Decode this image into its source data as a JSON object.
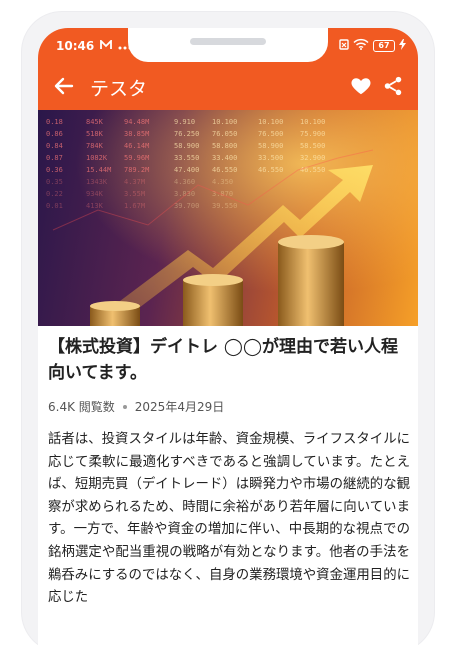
{
  "status_bar": {
    "time": "10:46",
    "battery_level": "67"
  },
  "app_bar": {
    "title": "テスタ"
  },
  "article": {
    "headline": "【株式投資】デイトレ ◯◯が理由で若い人程向いてます。",
    "views": "6.4K 閲覧数",
    "date": "2025年4月29日",
    "body": "話者は、投資スタイルは年齢、資金規模、ライフスタイルに応じて柔軟に最適化すべきであると強調しています。たとえば、短期売買（デイトレード）は瞬発力や市場の継続的な観察が求められるため、時間に余裕があり若年層に向いています。一方で、年齢や資金の増加に伴い、中長期的な視点での銘柄選定や配当重視の戦略が有効となります。他者の手法を鵜呑みにするのではなく、自身の業務環境や資金運用目的に応じた"
  },
  "hero_ticker_rows": [
    [
      "0.18",
      "845K",
      "94.48M",
      "9.910",
      "10.100",
      "10.100",
      "10.100"
    ],
    [
      "0.86",
      "518K",
      "38.85M",
      "76.250",
      "76.050",
      "76.500",
      "75.900"
    ],
    [
      "0.84",
      "784K",
      "46.14M",
      "58.900",
      "58.800",
      "58.900",
      "58.500"
    ],
    [
      "0.87",
      "1082K",
      "59.96M",
      "33.550",
      "33.400",
      "33.500",
      "32.900"
    ],
    [
      "0.36",
      "15.44M",
      "789.2M",
      "47.400",
      "46.550",
      "46.550",
      "46.550"
    ],
    [
      "0.35",
      "1343K",
      "4.37M",
      "4.360",
      "4.350",
      "",
      ""
    ],
    [
      "0.22",
      "934K",
      "3.55M",
      "3.830",
      "3.870",
      "",
      ""
    ],
    [
      "0.01",
      "413K",
      "1.67M",
      "39.700",
      "39.550",
      "",
      ""
    ]
  ],
  "colors": {
    "accent": "#f15a22",
    "text": "#222222",
    "meta": "#555555"
  },
  "icons": [
    "mail-icon",
    "more-dots-icon",
    "wifi-icon",
    "battery-icon",
    "charging-icon",
    "back-arrow-icon",
    "heart-icon",
    "share-icon"
  ]
}
